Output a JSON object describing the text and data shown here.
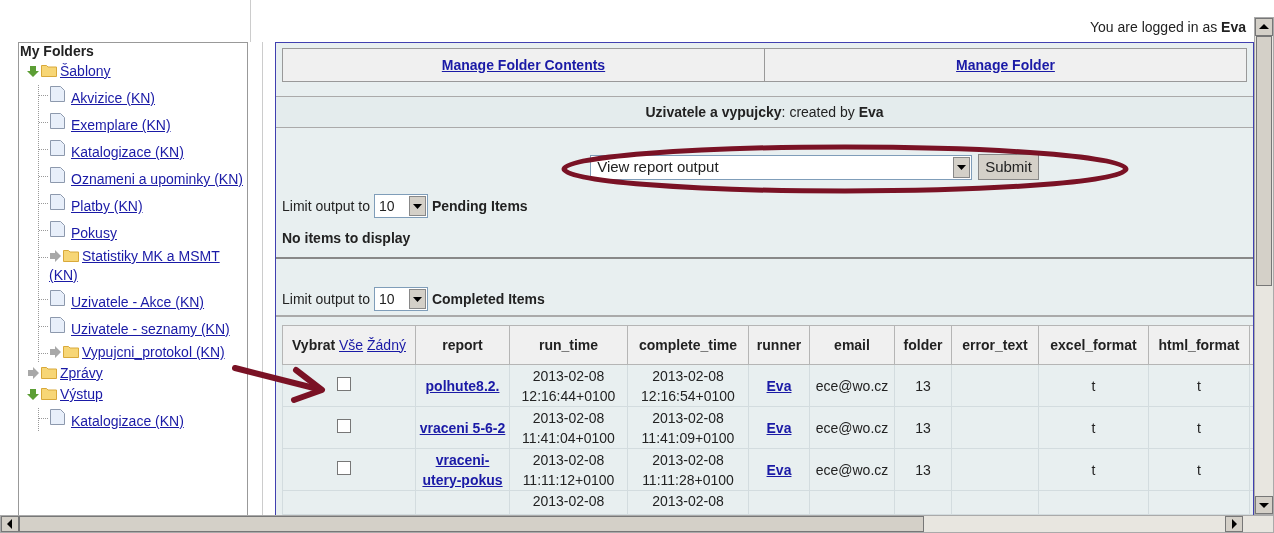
{
  "login_bar": {
    "text": "You are logged in as",
    "user": "Eva"
  },
  "sidebar": {
    "title": "My Folders",
    "tree": [
      {
        "kind": "folder",
        "label": "Šablony",
        "expanded": true,
        "children": [
          {
            "kind": "report",
            "label": "Akvizice (KN)"
          },
          {
            "kind": "report",
            "label": "Exemplare (KN)"
          },
          {
            "kind": "report",
            "label": "Katalogizace (KN)"
          },
          {
            "kind": "report",
            "label": "Oznameni a upominky (KN)"
          },
          {
            "kind": "report",
            "label": "Platby (KN)"
          },
          {
            "kind": "report",
            "label": "Pokusy"
          },
          {
            "kind": "folder",
            "label": "Statistiky MK a MSMT (KN)",
            "expanded": false
          },
          {
            "kind": "report",
            "label": "Uzivatele - Akce (KN)"
          },
          {
            "kind": "report",
            "label": "Uzivatele - seznamy (KN)"
          },
          {
            "kind": "folder",
            "label": "Vypujcni_protokol (KN)",
            "expanded": false
          }
        ]
      },
      {
        "kind": "folder",
        "label": "Zprávy",
        "expanded": false
      },
      {
        "kind": "folder",
        "label": "Výstup",
        "expanded": true,
        "children": [
          {
            "kind": "report",
            "label": "Katalogizace (KN)"
          }
        ]
      }
    ]
  },
  "tabs": [
    "Manage Folder Contents",
    "Manage Folder"
  ],
  "folder_title": "**Uzivatele a vypujcky**: created by **Eva**",
  "action": {
    "value": "View report output",
    "button": "Submit"
  },
  "pending": {
    "label": "Limit output to",
    "limit": "10",
    "heading": "Pending Items",
    "empty": "No items to display"
  },
  "completed": {
    "label": "Limit output to",
    "limit": "10",
    "heading": "Completed Items"
  },
  "table": {
    "select_column": {
      "label": "Vybrat",
      "links": [
        "Vše",
        "Žádný"
      ]
    },
    "columns": [
      "report",
      "run_time",
      "complete_time",
      "runner",
      "email",
      "folder",
      "error_text",
      "excel_format",
      "html_format"
    ],
    "rows": [
      {
        "checked": false,
        "report": "polhute8.2.",
        "run_time": "2013-02-08 12:16:44+0100",
        "complete_time": "2013-02-08 12:16:54+0100",
        "runner": "Eva",
        "email": "ece@wo.cz",
        "folder": "13",
        "error_text": "",
        "excel_format": "t",
        "html_format": "t"
      },
      {
        "checked": false,
        "report": "vraceni 5-6-2",
        "run_time": "2013-02-08 11:41:04+0100",
        "complete_time": "2013-02-08 11:41:09+0100",
        "runner": "Eva",
        "email": "ece@wo.cz",
        "folder": "13",
        "error_text": "",
        "excel_format": "t",
        "html_format": "t"
      },
      {
        "checked": false,
        "report": "vraceni-utery-pokus",
        "run_time": "2013-02-08 11:11:12+0100",
        "complete_time": "2013-02-08 11:11:28+0100",
        "runner": "Eva",
        "email": "ece@wo.cz",
        "folder": "13",
        "error_text": "",
        "excel_format": "t",
        "html_format": "t"
      }
    ],
    "partial_row": {
      "run_time": "2013-02-08",
      "complete_time": "2013-02-08"
    }
  }
}
